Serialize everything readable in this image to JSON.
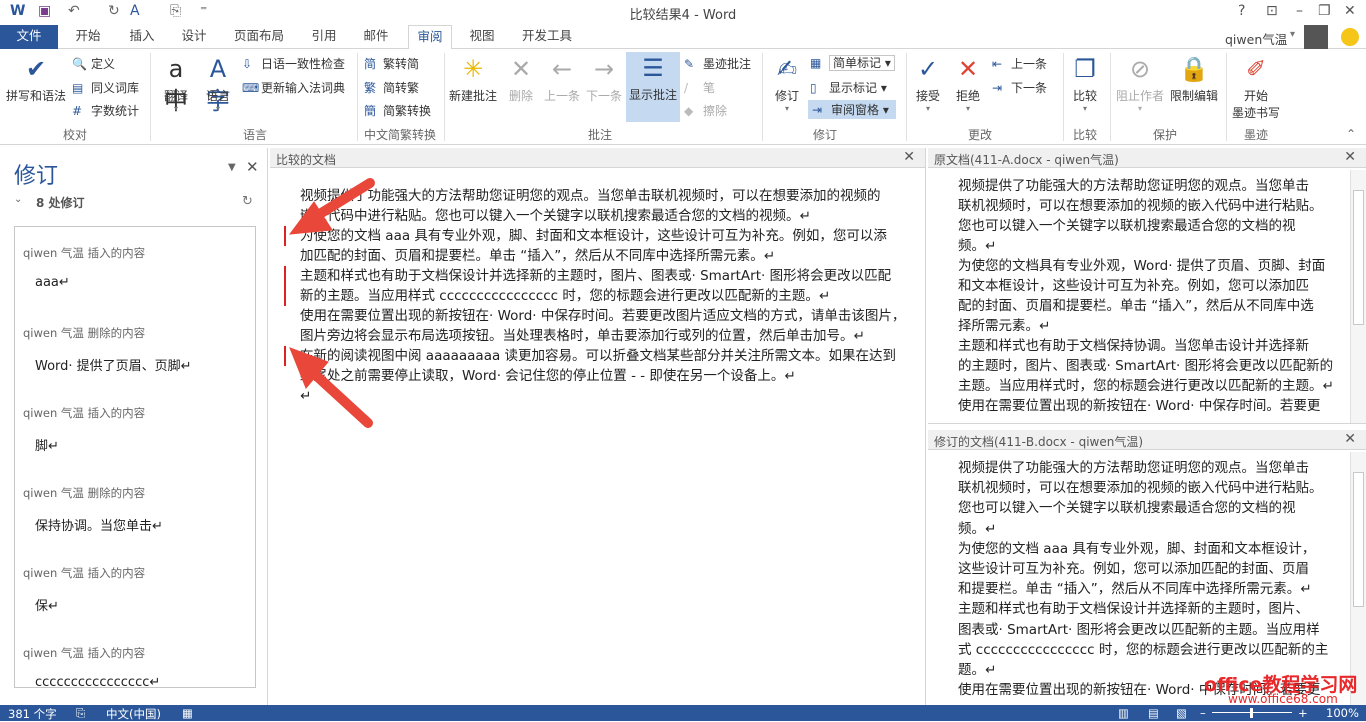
{
  "titlebar": {
    "title": "比较结果4 - Word",
    "help": "?",
    "ribbon_display": "⊡",
    "minimize": "–",
    "restore": "❐",
    "close": "✕",
    "user": "qiwen气温",
    "user_caret": "▾"
  },
  "tabs": [
    "文件",
    "开始",
    "插入",
    "设计",
    "页面布局",
    "引用",
    "邮件",
    "审阅",
    "视图",
    "开发工具"
  ],
  "ribbon": {
    "proofing": {
      "spell": "拼写和语法",
      "define": "定义",
      "thesaurus": "同义词库",
      "wordcount": "字数统计",
      "group": "校对"
    },
    "language": {
      "translate": "翻译",
      "language": "语言",
      "jp_check": "日语一致性检查",
      "update_ime": "更新输入法词典",
      "group": "语言"
    },
    "chinese": {
      "t2s": "繁转简",
      "s2t": "简转繁",
      "convert": "简繁转换",
      "group": "中文简繁转换"
    },
    "comments": {
      "new": "新建批注",
      "delete": "删除",
      "prev": "上一条",
      "next": "下一条",
      "show": "显示批注",
      "ink": "墨迹批注",
      "pen": "笔",
      "erase": "擦除",
      "group": "批注"
    },
    "tracking": {
      "track": "修订",
      "markup_mode": "简单标记",
      "show_markup": "显示标记",
      "review_pane": "审阅窗格",
      "group": "修订"
    },
    "changes": {
      "accept": "接受",
      "reject": "拒绝",
      "prev": "上一条",
      "next": "下一条",
      "group": "更改"
    },
    "compare": {
      "compare": "比较",
      "group": "比较"
    },
    "protect": {
      "block": "阻止作者",
      "restrict": "限制编辑",
      "group": "保护"
    },
    "ink": {
      "start_ink": "开始\n墨迹书写",
      "start_ink_1": "开始",
      "start_ink_2": "墨迹书写",
      "group": "墨迹"
    }
  },
  "revisions_pane": {
    "title": "修订",
    "count": "8 处修订",
    "items": [
      {
        "who": "qiwen 气温  插入的内容",
        "text": "aaa↵"
      },
      {
        "who": "qiwen 气温  删除的内容",
        "text": "Word· 提供了页眉、页脚↵"
      },
      {
        "who": "qiwen 气温  插入的内容",
        "text": "脚↵"
      },
      {
        "who": "qiwen 气温  删除的内容",
        "text": "保持协调。当您单击↵"
      },
      {
        "who": "qiwen 气温  插入的内容",
        "text": "保↵"
      },
      {
        "who": "qiwen 气温  插入的内容",
        "text": "cccccccccccccccc↵"
      }
    ]
  },
  "compared": {
    "title": "比较的文档",
    "lines": [
      "视频提供了功能强大的方法帮助您证明您的观点。当您单击联机视频时，可以在想要添加的视频的",
      "嵌入代码中进行粘贴。您也可以键入一个关键字以联机搜索最适合您的文档的视频。↵",
      "为使您的文档 aaa 具有专业外观，脚、封面和文本框设计，这些设计可互为补充。例如，您可以添",
      "加匹配的封面、页眉和提要栏。单击 “插入”，然后从不同库中选择所需元素。↵",
      "主题和样式也有助于文档保设计并选择新的主题时，图片、图表或· SmartArt· 图形将会更改以匹配",
      "新的主题。当应用样式 cccccccccccccccc 时，您的标题会进行更改以匹配新的主题。↵",
      "使用在需要位置出现的新按钮在· Word· 中保存时间。若要更改图片适应文档的方式，请单击该图片，",
      "图片旁边将会显示布局选项按钮。当处理表格时，单击要添加行或列的位置，然后单击加号。↵",
      "在新的阅读视图中阅 aaaaaaaaa 读更加容易。可以折叠文档某些部分并关注所需文本。如果在达到",
      "结尾处之前需要停止读取，Word· 会记住您的停止位置 - - 即使在另一个设备上。↵",
      "↵"
    ]
  },
  "original": {
    "title": "原文档(411-A.docx - qiwen气温)",
    "lines": [
      "视频提供了功能强大的方法帮助您证明您的观点。当您单击",
      "联机视频时，可以在想要添加的视频的嵌入代码中进行粘贴。",
      "您也可以键入一个关键字以联机搜索最适合您的文档的视",
      "频。↵",
      "为使您的文档具有专业外观，Word· 提供了页眉、页脚、封面",
      "和文本框设计，这些设计可互为补充。例如，您可以添加匹",
      "配的封面、页眉和提要栏。单击 “插入”，然后从不同库中选",
      "择所需元素。↵",
      "主题和样式也有助于文档保持协调。当您单击设计并选择新",
      "的主题时，图片、图表或· SmartArt· 图形将会更改以匹配新的",
      "主题。当应用样式时，您的标题会进行更改以匹配新的主题。↵",
      "使用在需要位置出现的新按钮在· Word· 中保存时间。若要更"
    ]
  },
  "revised": {
    "title": "修订的文档(411-B.docx - qiwen气温)",
    "lines": [
      "视频提供了功能强大的方法帮助您证明您的观点。当您单击",
      "联机视频时，可以在想要添加的视频的嵌入代码中进行粘贴。",
      "您也可以键入一个关键字以联机搜索最适合您的文档的视",
      "频。↵",
      "为使您的文档 aaa 具有专业外观，脚、封面和文本框设计，",
      "这些设计可互为补充。例如，您可以添加匹配的封面、页眉",
      "和提要栏。单击 “插入”，然后从不同库中选择所需元素。↵",
      "主题和样式也有助于文档保设计并选择新的主题时，图片、",
      "图表或· SmartArt· 图形将会更改以匹配新的主题。当应用样",
      "式 cccccccccccccccc 时，您的标题会进行更改以匹配新的主",
      "题。↵",
      "使用在需要位置出现的新按钮在· Word· 中保存时间。若要更"
    ]
  },
  "watermark": {
    "line1": "office教程学习网",
    "line2": "www.office68.com"
  },
  "status": {
    "words": "381 个字",
    "lang": "中文(中国)",
    "zoom": "100%"
  },
  "colors": {
    "accent": "#2b579a",
    "revision_bar": "#e02020",
    "arrow": "#e8473a"
  }
}
